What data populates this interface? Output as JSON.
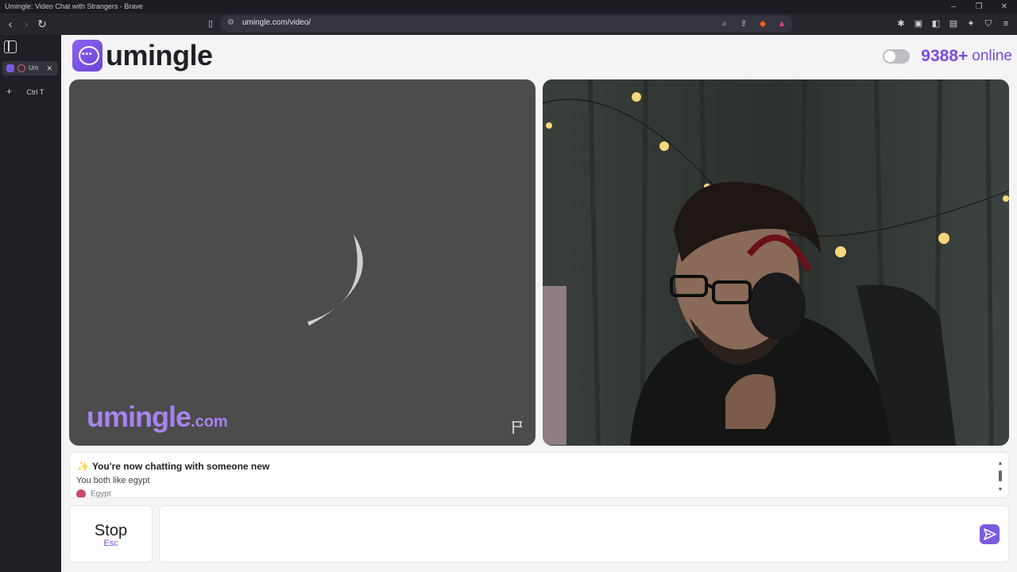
{
  "browser": {
    "window_title": "Umingle: Video Chat with Strangers - Brave",
    "url": "umingle.com/video/",
    "tab_label": "Um",
    "new_tab_label": "Ctrl  T"
  },
  "header": {
    "logo_text": "umingle",
    "online_count": "9388+",
    "online_word": "online"
  },
  "video_left": {
    "watermark_main": "umingle",
    "watermark_suffix": ".com"
  },
  "chat": {
    "system_message": "You're now chatting with someone new",
    "interest_message": "You both like egypt",
    "partial_message": "Egypt"
  },
  "controls": {
    "stop_label": "Stop",
    "stop_shortcut": "Esc",
    "message_placeholder": ""
  },
  "colors": {
    "accent": "#7b4ce0",
    "video_placeholder_bg": "#4c4c4c",
    "page_bg": "#f4f4f6"
  },
  "icons": {
    "report": "flag-icon",
    "send": "send-icon",
    "logo": "chat-bubble-icon"
  }
}
